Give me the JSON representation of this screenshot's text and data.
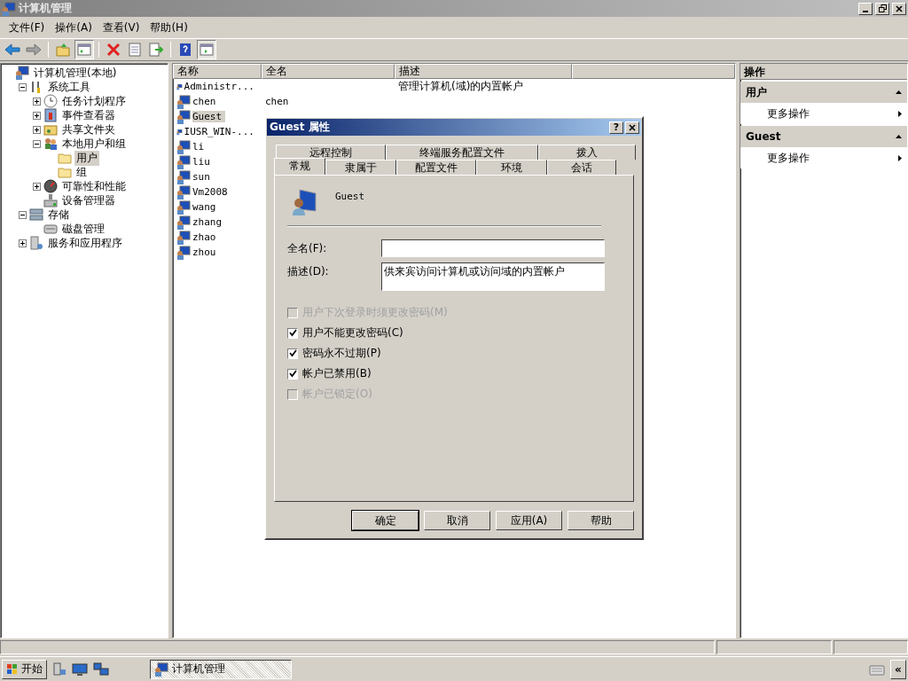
{
  "window": {
    "title": "计算机管理"
  },
  "menu": [
    "文件(F)",
    "操作(A)",
    "查看(V)",
    "帮助(H)"
  ],
  "toolbar": [
    {
      "kind": "back",
      "pressed": false
    },
    {
      "kind": "forward",
      "pressed": false
    },
    {
      "kind": "sep"
    },
    {
      "kind": "up",
      "pressed": false
    },
    {
      "kind": "tree",
      "pressed": true
    },
    {
      "kind": "sep"
    },
    {
      "kind": "delete",
      "pressed": false
    },
    {
      "kind": "properties",
      "pressed": false
    },
    {
      "kind": "export",
      "pressed": false
    },
    {
      "kind": "sep"
    },
    {
      "kind": "help",
      "pressed": false
    },
    {
      "kind": "pane",
      "pressed": true
    }
  ],
  "tree": [
    {
      "label": "计算机管理(本地)",
      "kind": "computer",
      "selected": false,
      "children": [
        {
          "label": "系统工具",
          "kind": "tools",
          "expanded": true,
          "selected": false,
          "children": [
            {
              "label": "任务计划程序",
              "kind": "clock",
              "expanded": false,
              "selected": false
            },
            {
              "label": "事件查看器",
              "kind": "event",
              "expanded": false,
              "selected": false
            },
            {
              "label": "共享文件夹",
              "kind": "share",
              "expanded": false,
              "selected": false
            },
            {
              "label": "本地用户和组",
              "kind": "users",
              "expanded": true,
              "selected": false,
              "children": [
                {
                  "label": "用户",
                  "kind": "folder",
                  "selected": true
                },
                {
                  "label": "组",
                  "kind": "folder",
                  "selected": false
                }
              ]
            },
            {
              "label": "可靠性和性能",
              "kind": "gauge",
              "expanded": false,
              "selected": false
            },
            {
              "label": "设备管理器",
              "kind": "device",
              "selected": false
            }
          ]
        },
        {
          "label": "存储",
          "kind": "storage",
          "expanded": true,
          "selected": false,
          "children": [
            {
              "label": "磁盘管理",
              "kind": "disk",
              "selected": false
            }
          ]
        },
        {
          "label": "服务和应用程序",
          "kind": "services",
          "expanded": false,
          "selected": false
        }
      ]
    }
  ],
  "list": {
    "columns": [
      "名称",
      "全名",
      "描述"
    ],
    "rows": [
      {
        "name": "Administr...",
        "full_name": "",
        "description": "管理计算机(域)的内置帐户",
        "selected": false
      },
      {
        "name": "chen",
        "full_name": "chen",
        "description": "",
        "selected": false
      },
      {
        "name": "Guest",
        "full_name": "",
        "description": "",
        "selected": true
      },
      {
        "name": "IUSR_WIN-...",
        "full_name": "",
        "description": "",
        "selected": false
      },
      {
        "name": "li",
        "full_name": "",
        "description": "",
        "selected": false
      },
      {
        "name": "liu",
        "full_name": "",
        "description": "",
        "selected": false
      },
      {
        "name": "sun",
        "full_name": "",
        "description": "",
        "selected": false
      },
      {
        "name": "Vm2008",
        "full_name": "",
        "description": "",
        "selected": false
      },
      {
        "name": "wang",
        "full_name": "",
        "description": "",
        "selected": false
      },
      {
        "name": "zhang",
        "full_name": "",
        "description": "",
        "selected": false
      },
      {
        "name": "zhao",
        "full_name": "",
        "description": "",
        "selected": false
      },
      {
        "name": "zhou",
        "full_name": "",
        "description": "",
        "selected": false
      }
    ]
  },
  "actions": {
    "title": "操作",
    "sections": [
      {
        "title": "用户",
        "expanded": true,
        "items": [
          "更多操作"
        ]
      },
      {
        "title": "Guest",
        "expanded": true,
        "items": [
          "更多操作"
        ]
      }
    ]
  },
  "dialog": {
    "title": "Guest 属性",
    "help": "?",
    "tabs_back": [
      {
        "label": "远程控制",
        "selected": false
      },
      {
        "label": "终端服务配置文件",
        "selected": false
      },
      {
        "label": "拨入",
        "selected": false
      }
    ],
    "tabs_front": [
      {
        "label": "常规",
        "selected": true
      },
      {
        "label": "隶属于",
        "selected": false
      },
      {
        "label": "配置文件",
        "selected": false
      },
      {
        "label": "环境",
        "selected": false
      },
      {
        "label": "会话",
        "selected": false
      }
    ],
    "user": "Guest",
    "fields": [
      {
        "label": "全名(F):",
        "kind": "line"
      },
      {
        "label": "描述(D):",
        "value": "供来宾访问计算机或访问域的内置帐户",
        "kind": "area"
      }
    ],
    "checkboxes": [
      {
        "label": "用户下次登录时须更改密码(M)",
        "checked": false,
        "disabled": true
      },
      {
        "label": "用户不能更改密码(C)",
        "checked": true,
        "disabled": false
      },
      {
        "label": "密码永不过期(P)",
        "checked": true,
        "disabled": false
      },
      {
        "label": "帐户已禁用(B)",
        "checked": true,
        "disabled": false
      },
      {
        "label": "帐户已锁定(O)",
        "checked": false,
        "disabled": true
      }
    ],
    "buttons": [
      {
        "label": "确定",
        "default": true
      },
      {
        "label": "取消",
        "default": false
      },
      {
        "label": "应用(A)",
        "default": false
      },
      {
        "label": "帮助",
        "default": false
      }
    ]
  },
  "taskbar": {
    "start": "开始",
    "tasks": [
      {
        "label": "计算机管理",
        "selected": true
      }
    ],
    "tray_toggle": "«"
  }
}
